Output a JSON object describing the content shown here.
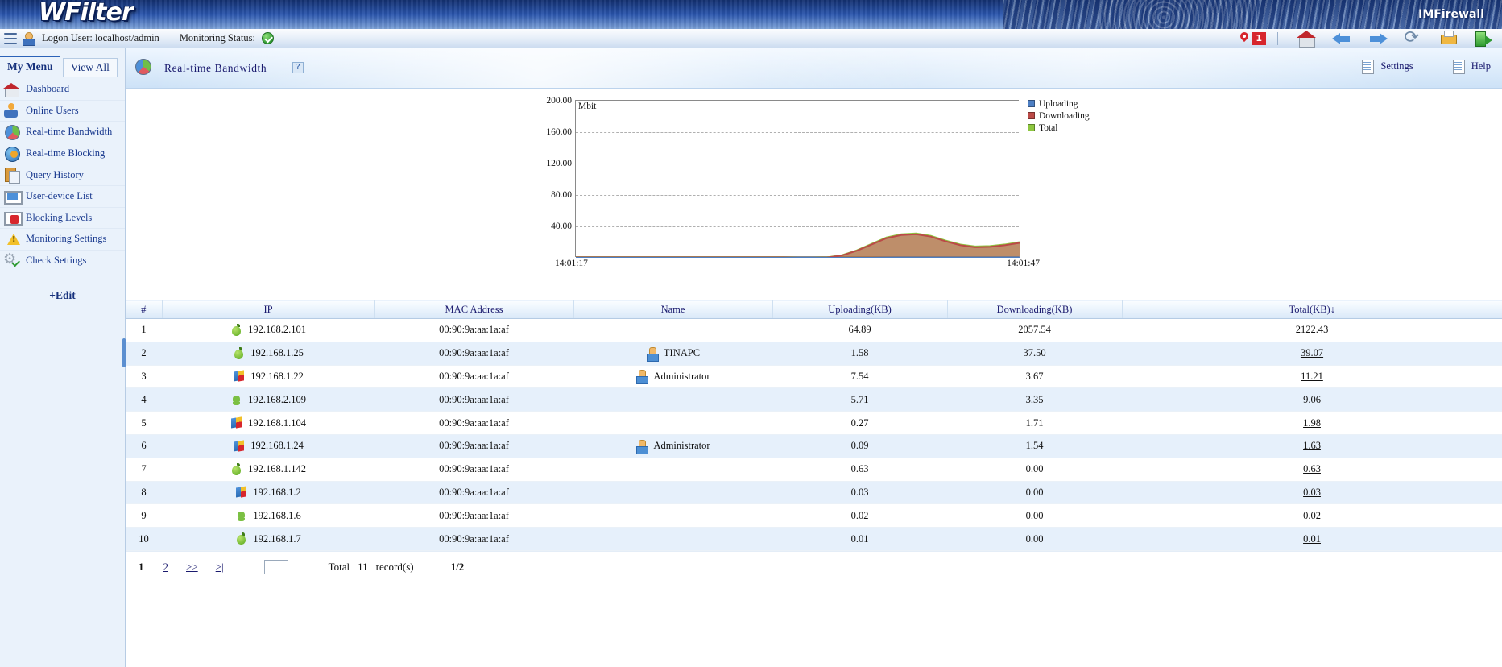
{
  "banner": {
    "product": "WFilter",
    "vendor": "IMFirewall"
  },
  "statusbar": {
    "user_label": "Logon User: localhost/admin",
    "monitoring_label": "Monitoring Status:",
    "status_icon": "green-check-icon",
    "alert_count": "1",
    "icons": [
      "pin-icon",
      "home-icon",
      "back-arrow-icon",
      "forward-arrow-icon",
      "refresh-icon",
      "print-icon",
      "exit-icon"
    ]
  },
  "sidebar": {
    "tabs": [
      {
        "label": "My Menu",
        "active": true
      },
      {
        "label": "View All",
        "active": false
      }
    ],
    "items": [
      {
        "label": "Dashboard",
        "icon": "home-icon"
      },
      {
        "label": "Online Users",
        "icon": "users-icon"
      },
      {
        "label": "Real-time Bandwidth",
        "icon": "pie-chart-icon"
      },
      {
        "label": "Real-time Blocking",
        "icon": "globe-gear-icon"
      },
      {
        "label": "Query History",
        "icon": "clipboard-icon"
      },
      {
        "label": "User-device List",
        "icon": "monitor-icon"
      },
      {
        "label": "Blocking Levels",
        "icon": "monitor-alert-icon"
      },
      {
        "label": "Monitoring Settings",
        "icon": "warning-gear-icon"
      },
      {
        "label": "Check Settings",
        "icon": "gear-check-icon"
      }
    ],
    "edit_label": "+Edit"
  },
  "content_header": {
    "title": "Real-time Bandwidth",
    "help_badge": "?",
    "settings_label": "Settings",
    "help_label": "Help"
  },
  "chart_data": {
    "type": "area",
    "title": "Real-time Bandwidth",
    "ylabel": "Mbit",
    "xlabel": "",
    "ylim": [
      0,
      200
    ],
    "yticks": [
      200.0,
      160.0,
      120.0,
      80.0,
      40.0
    ],
    "ytick_labels": [
      "200.00",
      "160.00",
      "120.00",
      "80.00",
      "40.00"
    ],
    "grid": true,
    "legend_position": "right",
    "x_start_label": "14:01:17",
    "x_end_label": "14:01:47",
    "x": [
      0,
      1,
      2,
      3,
      4,
      5,
      6,
      7,
      8,
      9,
      10,
      11,
      12,
      13,
      14,
      15,
      16,
      17,
      18,
      19,
      20,
      21,
      22,
      23,
      24,
      25,
      26,
      27,
      28,
      29,
      30
    ],
    "series": [
      {
        "name": "Uploading",
        "color": "#4d7fc4",
        "values": [
          0,
          0,
          0,
          0,
          0,
          0,
          0,
          0,
          0,
          0,
          0,
          0,
          0,
          0,
          0,
          0,
          0,
          0,
          0,
          0,
          0,
          0.3,
          0.4,
          0.4,
          0.4,
          0.4,
          0.4,
          0.4,
          0.4,
          0.5,
          0.5
        ]
      },
      {
        "name": "Downloading",
        "color": "#bb4a47",
        "values": [
          0.5,
          0.5,
          0.5,
          0.5,
          0.5,
          0.5,
          0.5,
          0.5,
          0.5,
          0.5,
          0.5,
          0.5,
          0.5,
          0.5,
          0.5,
          0,
          0,
          0.4,
          3,
          9,
          17,
          25,
          29,
          30,
          27,
          21,
          16,
          13.5,
          14,
          16,
          19
        ]
      },
      {
        "name": "Total",
        "color": "#8dc63f",
        "values": [
          0.8,
          0.8,
          0.8,
          0.8,
          0.8,
          0.8,
          0.8,
          0.8,
          0.8,
          0.8,
          0.8,
          0.8,
          0.8,
          0.8,
          0.8,
          0,
          0,
          0.6,
          3.4,
          9.6,
          17.8,
          26,
          30,
          31,
          28,
          22,
          17,
          14.5,
          15,
          17,
          20
        ]
      }
    ]
  },
  "table": {
    "columns": [
      "#",
      "IP",
      "MAC Address",
      "Name",
      "Uploading(KB)",
      "Downloading(KB)",
      "Total(KB)"
    ],
    "sort_column": "Total(KB)",
    "sort_indicator": "↓",
    "rows": [
      {
        "num": "1",
        "os": "apple-icon",
        "ip": "192.168.2.101",
        "mac": "00:90:9a:aa:1a:af",
        "name": "",
        "up": "64.89",
        "down": "2057.54",
        "total": "2122.43"
      },
      {
        "num": "2",
        "os": "apple-icon",
        "ip": "192.168.1.25",
        "mac": "00:90:9a:aa:1a:af",
        "name": "TINAPC",
        "up": "1.58",
        "down": "37.50",
        "total": "39.07"
      },
      {
        "num": "3",
        "os": "windows-icon",
        "ip": "192.168.1.22",
        "mac": "00:90:9a:aa:1a:af",
        "name": "Administrator",
        "up": "7.54",
        "down": "3.67",
        "total": "11.21"
      },
      {
        "num": "4",
        "os": "android-icon",
        "ip": "192.168.2.109",
        "mac": "00:90:9a:aa:1a:af",
        "name": "",
        "up": "5.71",
        "down": "3.35",
        "total": "9.06"
      },
      {
        "num": "5",
        "os": "windows-icon",
        "ip": "192.168.1.104",
        "mac": "00:90:9a:aa:1a:af",
        "name": "",
        "up": "0.27",
        "down": "1.71",
        "total": "1.98"
      },
      {
        "num": "6",
        "os": "windows-icon",
        "ip": "192.168.1.24",
        "mac": "00:90:9a:aa:1a:af",
        "name": "Administrator",
        "up": "0.09",
        "down": "1.54",
        "total": "1.63"
      },
      {
        "num": "7",
        "os": "apple-icon",
        "ip": "192.168.1.142",
        "mac": "00:90:9a:aa:1a:af",
        "name": "",
        "up": "0.63",
        "down": "0.00",
        "total": "0.63"
      },
      {
        "num": "8",
        "os": "windows-icon",
        "ip": "192.168.1.2",
        "mac": "00:90:9a:aa:1a:af",
        "name": "",
        "up": "0.03",
        "down": "0.00",
        "total": "0.03"
      },
      {
        "num": "9",
        "os": "android-icon",
        "ip": "192.168.1.6",
        "mac": "00:90:9a:aa:1a:af",
        "name": "",
        "up": "0.02",
        "down": "0.00",
        "total": "0.02"
      },
      {
        "num": "10",
        "os": "apple-icon",
        "ip": "192.168.1.7",
        "mac": "00:90:9a:aa:1a:af",
        "name": "",
        "up": "0.01",
        "down": "0.00",
        "total": "0.01"
      }
    ]
  },
  "footer": {
    "page_current": "1",
    "page_next": "2",
    "page_fwd": ">>",
    "page_last": ">|",
    "jump_value": "",
    "total_label": "Total",
    "record_count": "11",
    "record_word": "record(s)",
    "page_ratio": "1/2"
  }
}
